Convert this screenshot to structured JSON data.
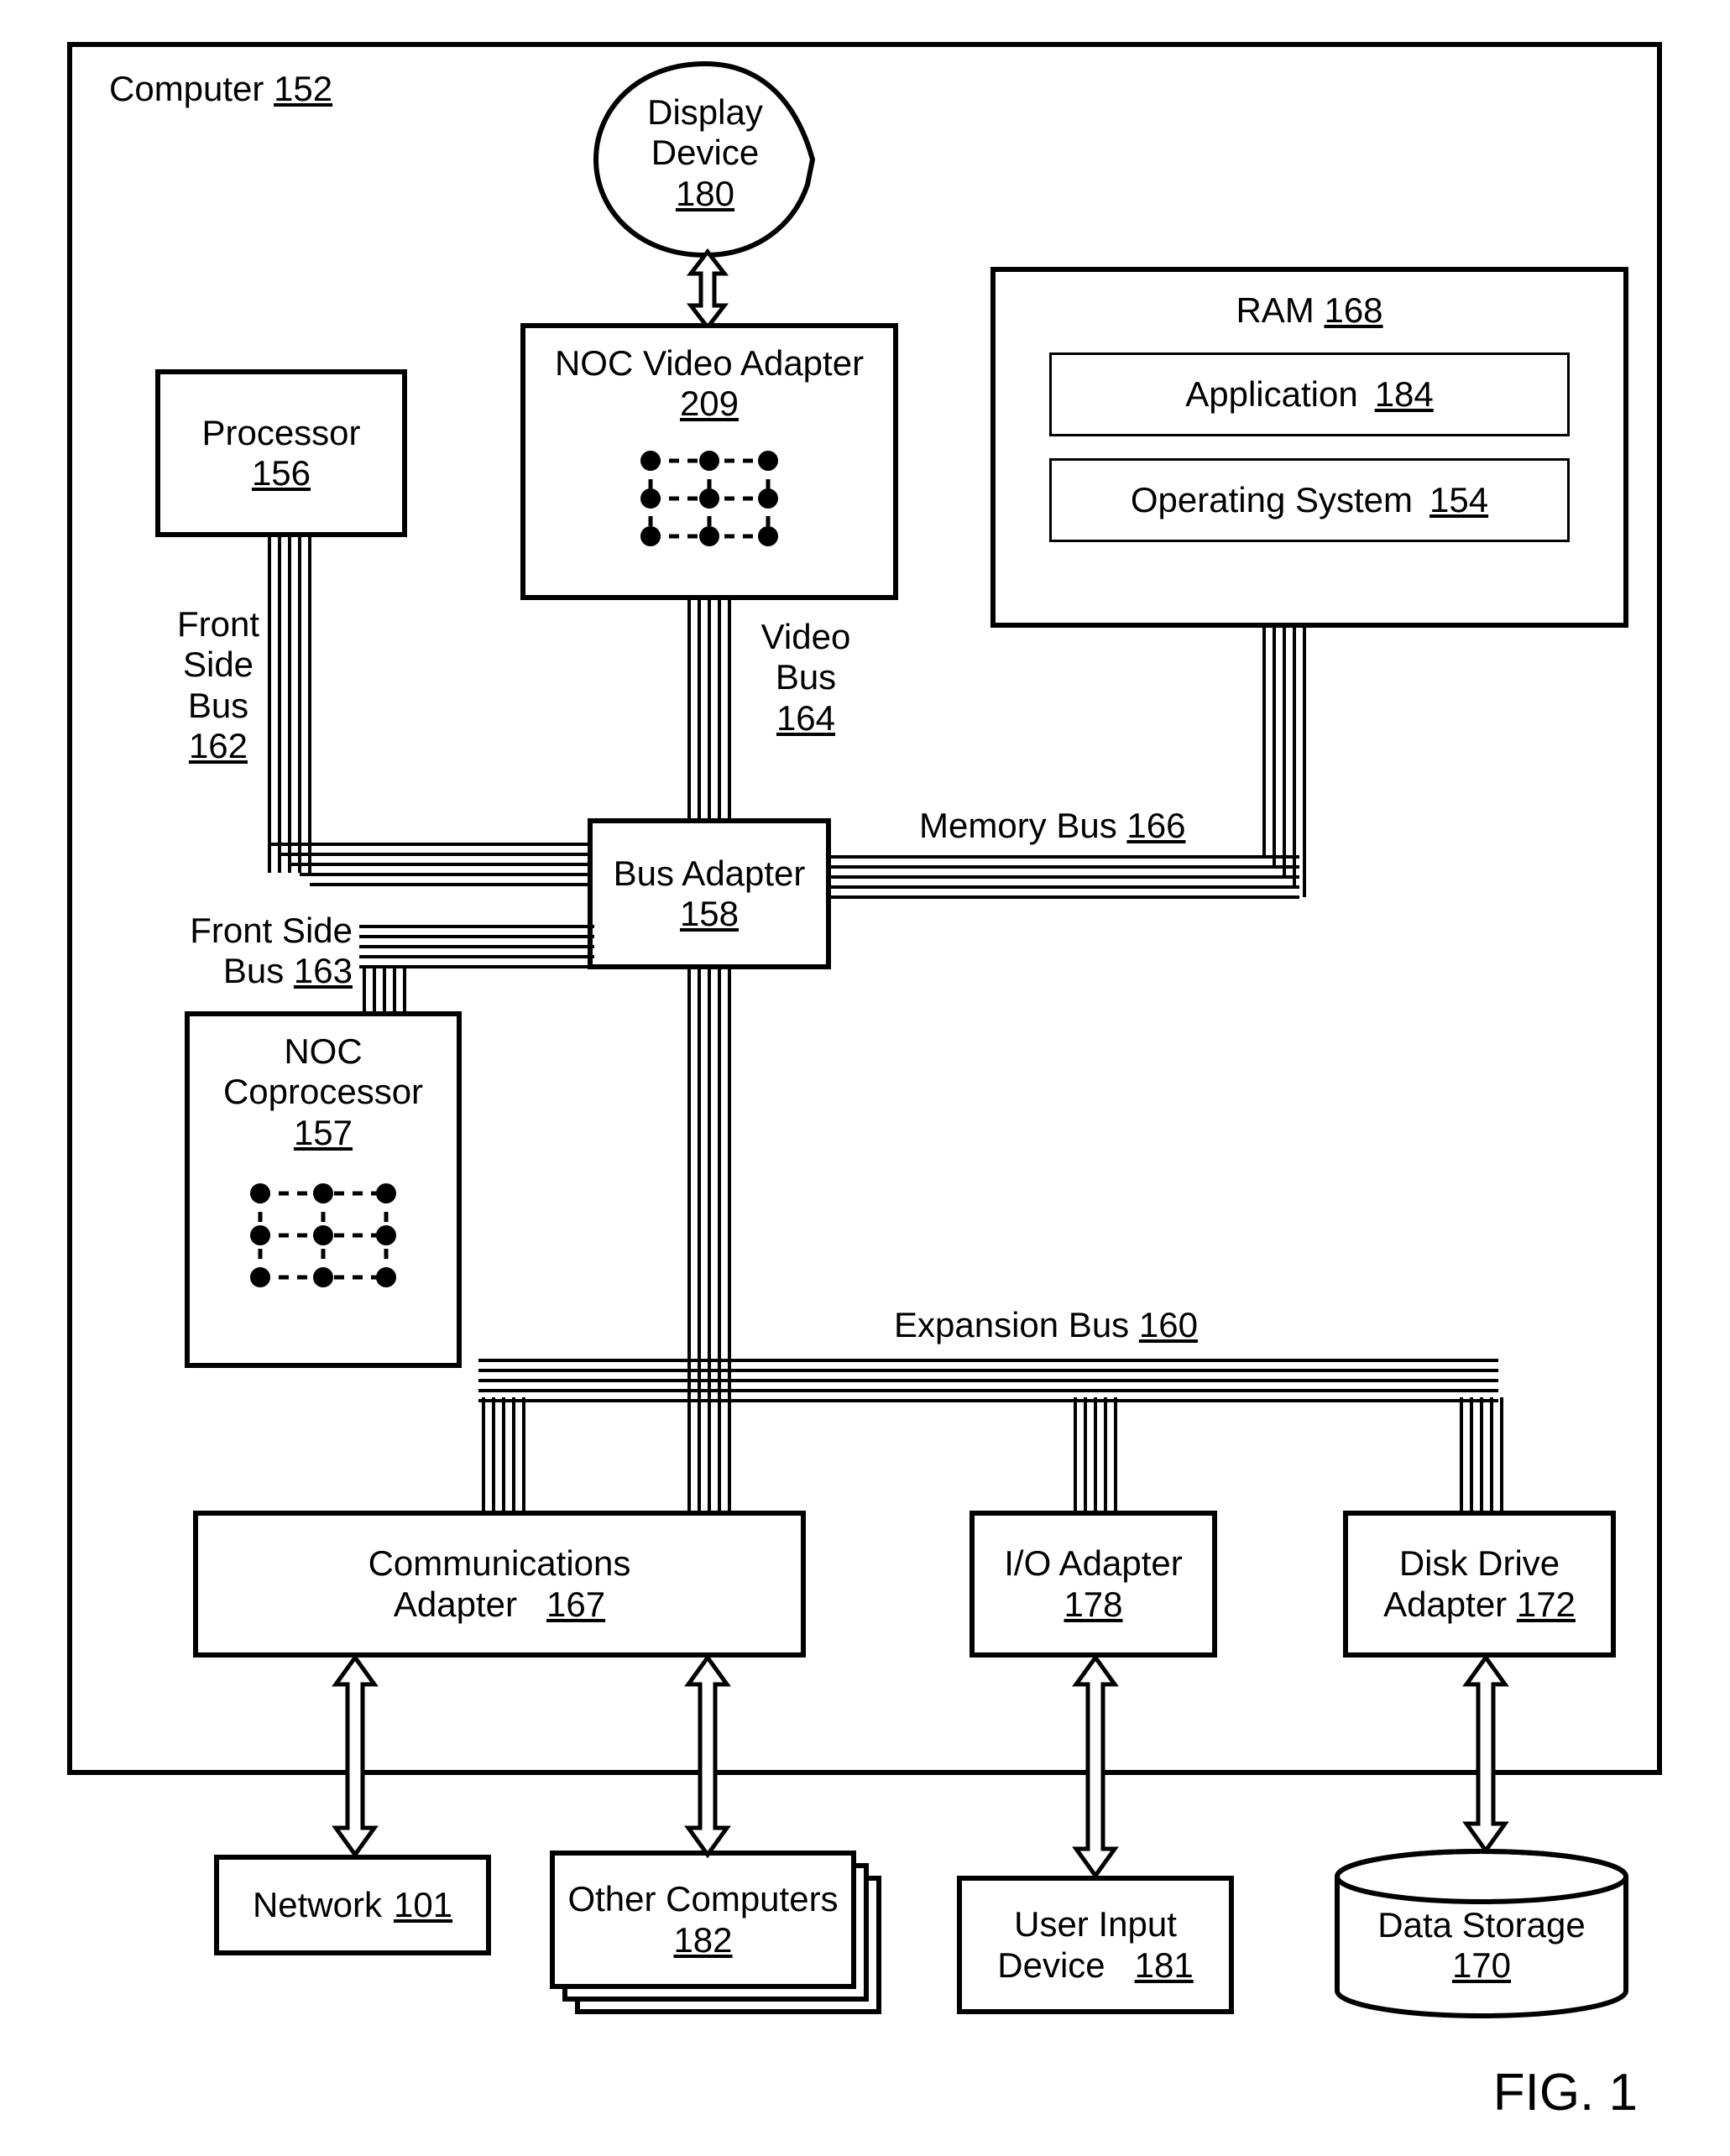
{
  "figure": "FIG. 1",
  "computer": {
    "label": "Computer",
    "ref": "152"
  },
  "displayDevice": {
    "l1": "Display",
    "l2": "Device",
    "ref": "180"
  },
  "processor": {
    "label": "Processor",
    "ref": "156"
  },
  "nocVideoAdapter": {
    "label": "NOC Video Adapter",
    "ref": "209"
  },
  "ram": {
    "label": "RAM",
    "ref": "168"
  },
  "application": {
    "label": "Application",
    "ref": "184"
  },
  "os": {
    "label": "Operating System",
    "ref": "154"
  },
  "busAdapter": {
    "label": "Bus Adapter",
    "ref": "158"
  },
  "frontSideBus162": {
    "l1": "Front",
    "l2": "Side",
    "l3": "Bus",
    "ref": "162"
  },
  "videoBus164": {
    "l1": "Video",
    "l2": "Bus",
    "ref": "164"
  },
  "memoryBus166": {
    "label": "Memory Bus",
    "ref": "166"
  },
  "frontSideBus163": {
    "l1": "Front Side",
    "l2": "Bus",
    "ref": "163"
  },
  "nocCoprocessor": {
    "l1": "NOC",
    "l2": "Coprocessor",
    "ref": "157"
  },
  "expansionBus160": {
    "label": "Expansion Bus",
    "ref": "160"
  },
  "commAdapter": {
    "l1": "Communications",
    "l2": "Adapter",
    "ref": "167"
  },
  "ioAdapter": {
    "label": "I/O Adapter",
    "ref": "178"
  },
  "diskDriveAdapter": {
    "l1": "Disk Drive",
    "l2": "Adapter",
    "ref": "172"
  },
  "network": {
    "label": "Network",
    "ref": "101"
  },
  "otherComputers": {
    "label": "Other Computers",
    "ref": "182"
  },
  "userInputDevice": {
    "l1": "User Input",
    "l2": "Device",
    "ref": "181"
  },
  "dataStorage": {
    "label": "Data Storage",
    "ref": "170"
  }
}
